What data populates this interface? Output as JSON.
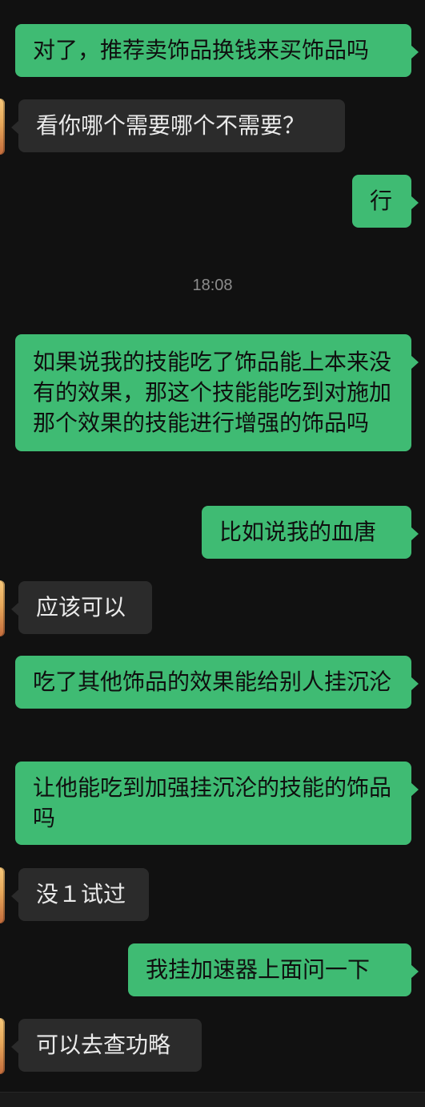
{
  "messages": [
    {
      "side": "sent",
      "text": "对了，推荐卖饰品换钱来买饰品吗"
    },
    {
      "side": "recv",
      "text": "看你哪个需要哪个不需要？"
    },
    {
      "side": "sent",
      "text": "行"
    },
    {
      "side": "sent",
      "text": "如果说我的技能吃了饰品能上本来没有的效果，那这个技能能吃到对施加那个效果的技能进行增强的饰品吗"
    },
    {
      "side": "sent",
      "text": "比如说我的血唐"
    },
    {
      "side": "recv",
      "text": "应该可以"
    },
    {
      "side": "sent",
      "text": "吃了其他饰品的效果能给别人挂沉沦"
    },
    {
      "side": "sent",
      "text": "让他能吃到加强挂沉沦的技能的饰品吗"
    },
    {
      "side": "recv",
      "text": "没１试过"
    },
    {
      "side": "sent",
      "text": "我挂加速器上面问一下"
    },
    {
      "side": "recv",
      "text": "可以去查功略"
    }
  ],
  "timestamp": "18:08",
  "colors": {
    "background": "#111111",
    "sent_bubble": "#3fbb73",
    "received_bubble": "#2b2b2b"
  }
}
